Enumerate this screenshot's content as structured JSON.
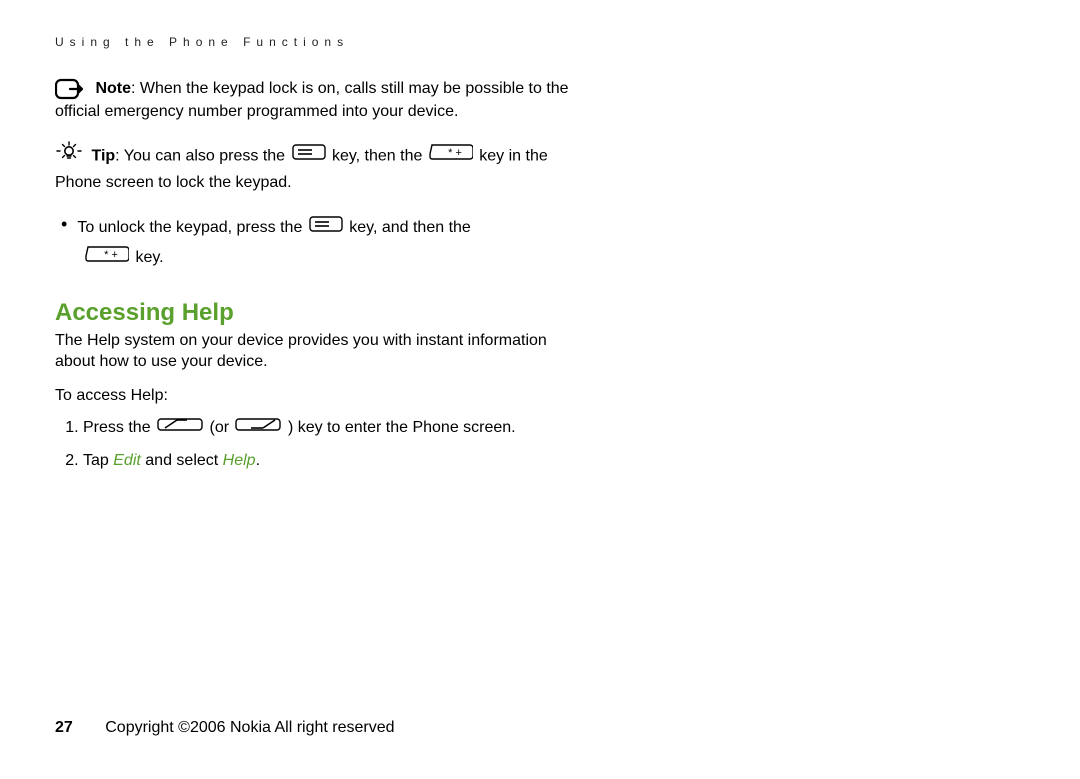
{
  "header": {
    "running_title": "Using the Phone Functions"
  },
  "note": {
    "label": "Note",
    "text1": ": When the keypad lock is on, calls still may be possible to the official emergency number programmed into your device."
  },
  "tip": {
    "label": "Tip",
    "pre": ": You can also press the ",
    "mid": " key, then the ",
    "tail": " key in the Phone screen to lock the keypad."
  },
  "bullet": {
    "pre": "To unlock the keypad, press the ",
    "mid": " key, and then the ",
    "tail": " key."
  },
  "section": {
    "heading": "Accessing Help",
    "body": "The Help system on your device provides you with instant information about how to use your device.",
    "to_access": "To access Help:"
  },
  "steps": {
    "s1_pre": "Press the ",
    "s1_or": " (or ",
    "s1_post": ") key to enter the Phone screen.",
    "s2_pre": "Tap ",
    "s2_edit": "Edit",
    "s2_mid": " and select ",
    "s2_help": "Help",
    "s2_end": "."
  },
  "footer": {
    "page": "27",
    "copyright": "Copyright ©2006 Nokia All right reserved"
  }
}
